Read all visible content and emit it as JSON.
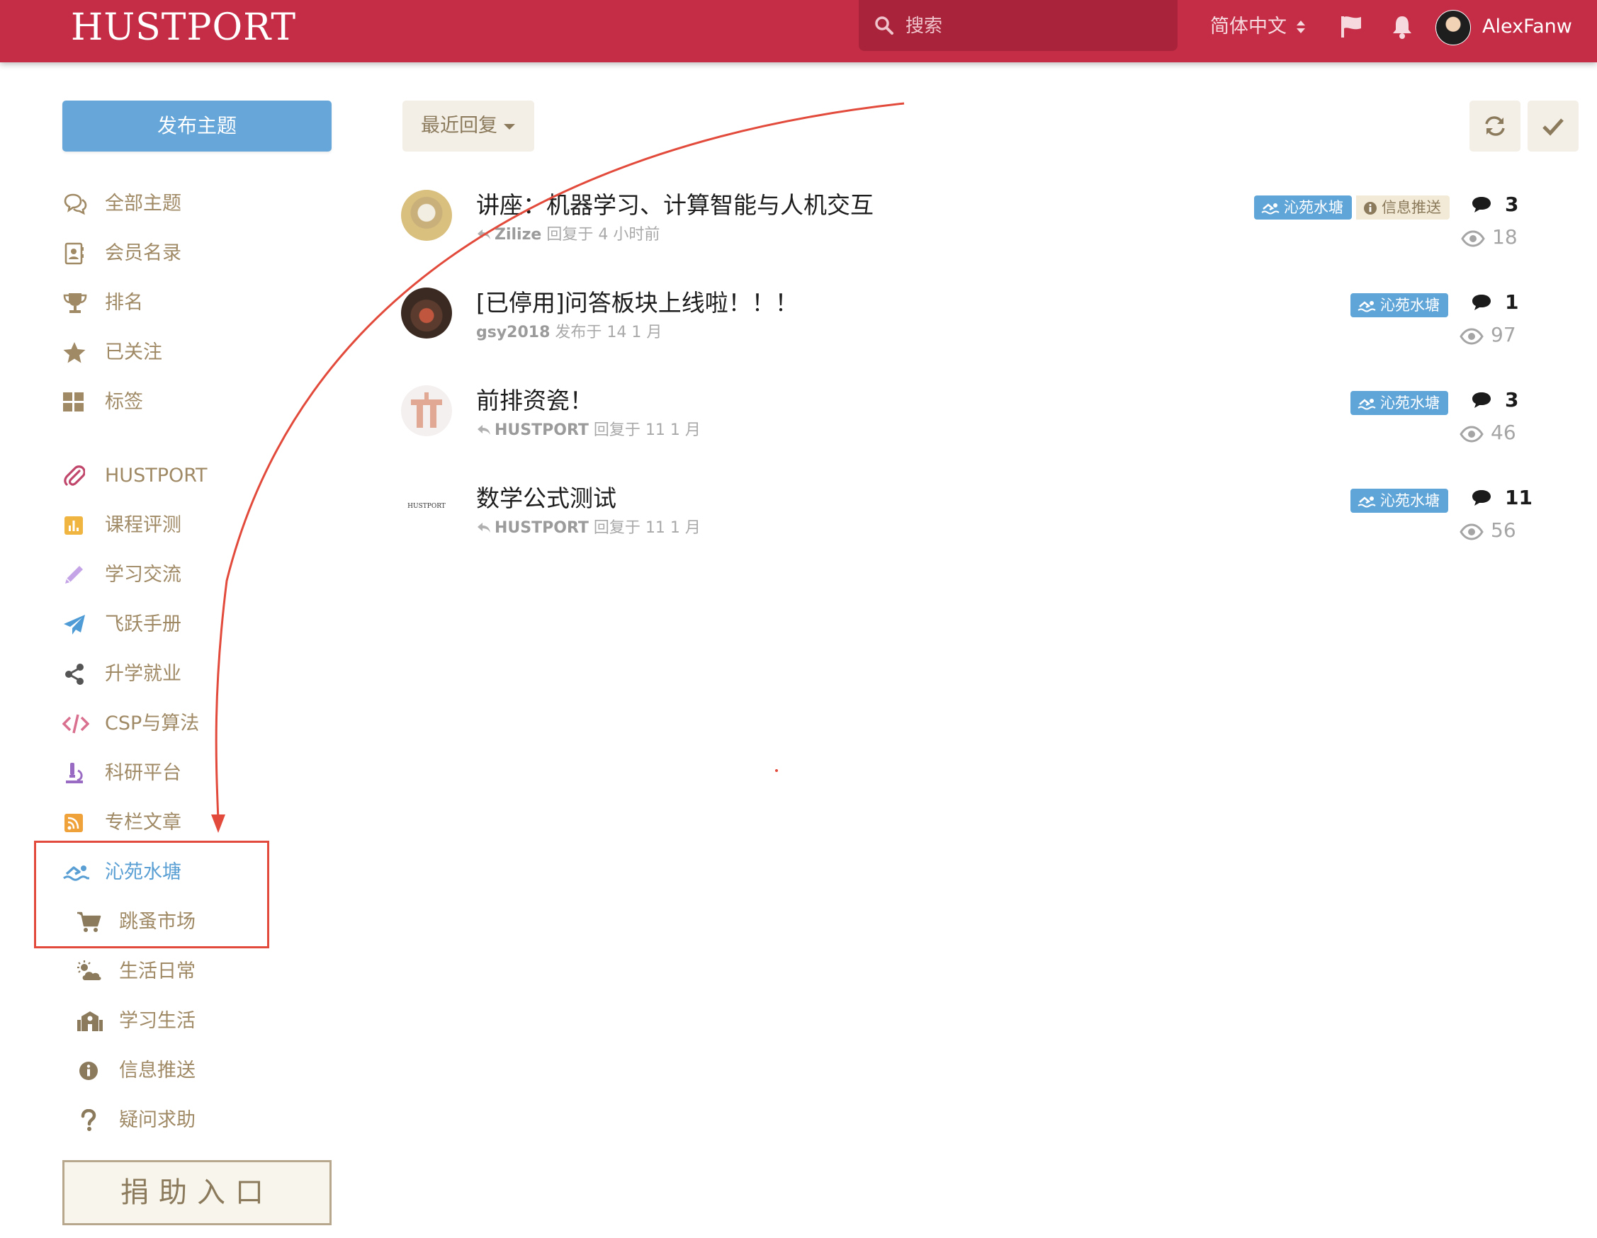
{
  "header": {
    "logo": "HUSTPORT",
    "search_placeholder": "搜索",
    "language": "简体中文",
    "username": "AlexFanw",
    "icons": [
      "search-icon",
      "sort-arrows-icon",
      "flag-icon",
      "bell-icon",
      "user-avatar"
    ]
  },
  "sidebar": {
    "post_button": "发布主题",
    "nav": [
      {
        "label": "全部主题",
        "icon": "comments-icon"
      },
      {
        "label": "会员名录",
        "icon": "address-book-icon"
      },
      {
        "label": "排名",
        "icon": "trophy-icon"
      },
      {
        "label": "已关注",
        "icon": "star-icon"
      },
      {
        "label": "标签",
        "icon": "grid-icon"
      }
    ],
    "tags": [
      {
        "label": "HUSTPORT",
        "icon": "paperclip-icon",
        "color": "#c0476b"
      },
      {
        "label": "课程评测",
        "icon": "bar-chart-icon",
        "color": "#f0b441"
      },
      {
        "label": "学习交流",
        "icon": "pencil-icon",
        "color": "#c4a3e6"
      },
      {
        "label": "飞跃手册",
        "icon": "paper-plane-icon",
        "color": "#4f9bd6"
      },
      {
        "label": "升学就业",
        "icon": "share-icon",
        "color": "#555555"
      },
      {
        "label": "CSP与算法",
        "icon": "code-icon",
        "color": "#d9708f"
      },
      {
        "label": "科研平台",
        "icon": "microscope-icon",
        "color": "#9a6bc2"
      },
      {
        "label": "专栏文章",
        "icon": "rss-icon",
        "color": "#f0a23a"
      },
      {
        "label": "沁苑水塘",
        "icon": "swimmer-icon",
        "color": "#5a9fd4",
        "active": true
      },
      {
        "label": "跳蚤市场",
        "icon": "cart-icon",
        "color": "#8b7a5c"
      },
      {
        "label": "生活日常",
        "icon": "cloud-sun-icon",
        "color": "#8b7a5c"
      },
      {
        "label": "学习生活",
        "icon": "school-icon",
        "color": "#8b7a5c"
      },
      {
        "label": "信息推送",
        "icon": "info-circle-icon",
        "color": "#8b7a5c"
      },
      {
        "label": "疑问求助",
        "icon": "question-icon",
        "color": "#8b7a5c"
      }
    ],
    "donate_button": "捐助入口"
  },
  "toolbar": {
    "sort_label": "最近回复",
    "refresh_icon": "refresh-icon",
    "mark_read_icon": "check-icon"
  },
  "discussions": [
    {
      "title": "讲座：机器学习、计算智能与人机交互",
      "author": "Zilize",
      "action": "回复于",
      "time": "4 小时前",
      "reply_icon": true,
      "tags": [
        {
          "label": "沁苑水塘",
          "style": "blue"
        },
        {
          "label": "信息推送",
          "style": "beige"
        }
      ],
      "replies": "3",
      "views": "18"
    },
    {
      "title": "[已停用]问答板块上线啦！！！",
      "author": "gsy2018",
      "action": "发布于",
      "time": "14 1 月",
      "reply_icon": false,
      "tags": [
        {
          "label": "沁苑水塘",
          "style": "blue"
        }
      ],
      "replies": "1",
      "views": "97"
    },
    {
      "title": "前排资瓷！",
      "author": "HUSTPORT",
      "action": "回复于",
      "time": "11 1 月",
      "reply_icon": true,
      "tags": [
        {
          "label": "沁苑水塘",
          "style": "blue"
        }
      ],
      "replies": "3",
      "views": "46"
    },
    {
      "title": "数学公式测试",
      "author": "HUSTPORT",
      "action": "回复于",
      "time": "11 1 月",
      "reply_icon": true,
      "tags": [
        {
          "label": "沁苑水塘",
          "style": "blue"
        }
      ],
      "replies": "11",
      "views": "56",
      "avatar_text": "HUSTPORT"
    }
  ],
  "annotation": {
    "color": "#e24a3b"
  }
}
